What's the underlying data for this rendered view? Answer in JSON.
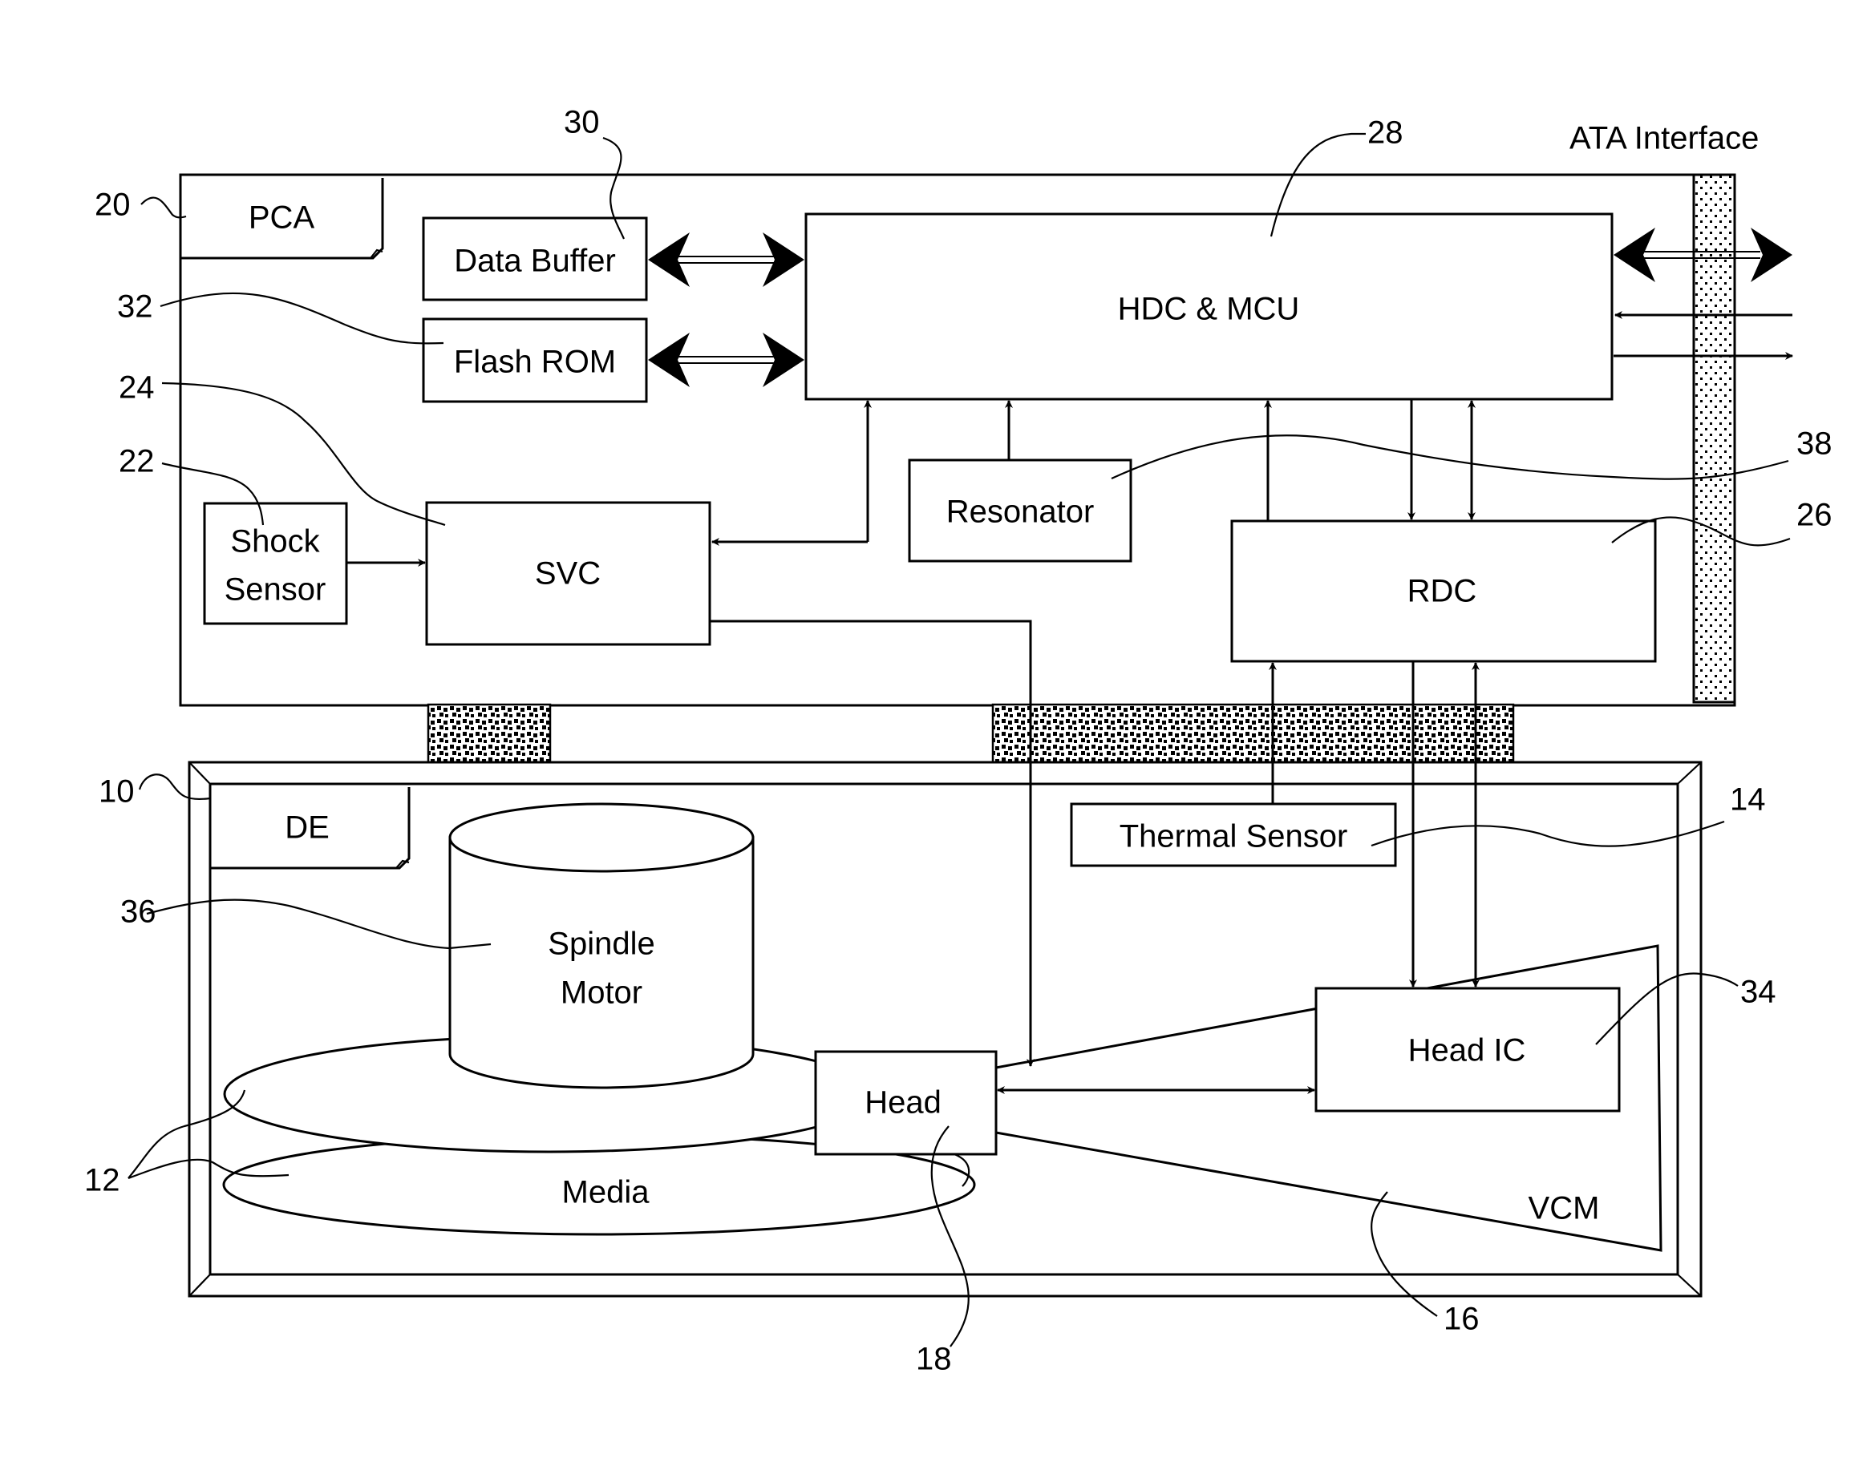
{
  "diagram": {
    "external_label": "ATA Interface",
    "blocks": {
      "pca": "PCA",
      "data_buffer": "Data Buffer",
      "flash_rom": "Flash ROM",
      "hdc_mcu": "HDC & MCU",
      "resonator": "Resonator",
      "shock_sensor_line1": "Shock",
      "shock_sensor_line2": "Sensor",
      "svc": "SVC",
      "rdc": "RDC",
      "de": "DE",
      "thermal_sensor": "Thermal Sensor",
      "spindle_motor_line1": "Spindle",
      "spindle_motor_line2": "Motor",
      "media": "Media",
      "head": "Head",
      "head_ic": "Head IC",
      "vcm": "VCM"
    },
    "reference_numerals": {
      "de": "10",
      "media": "12",
      "thermal_sensor": "14",
      "vcm": "16",
      "head": "18",
      "pca": "20",
      "shock_sensor": "22",
      "svc": "24",
      "rdc": "26",
      "hdc_mcu": "28",
      "data_buffer": "30",
      "flash_rom": "32",
      "head_ic": "34",
      "spindle_motor": "36",
      "resonator": "38"
    }
  }
}
